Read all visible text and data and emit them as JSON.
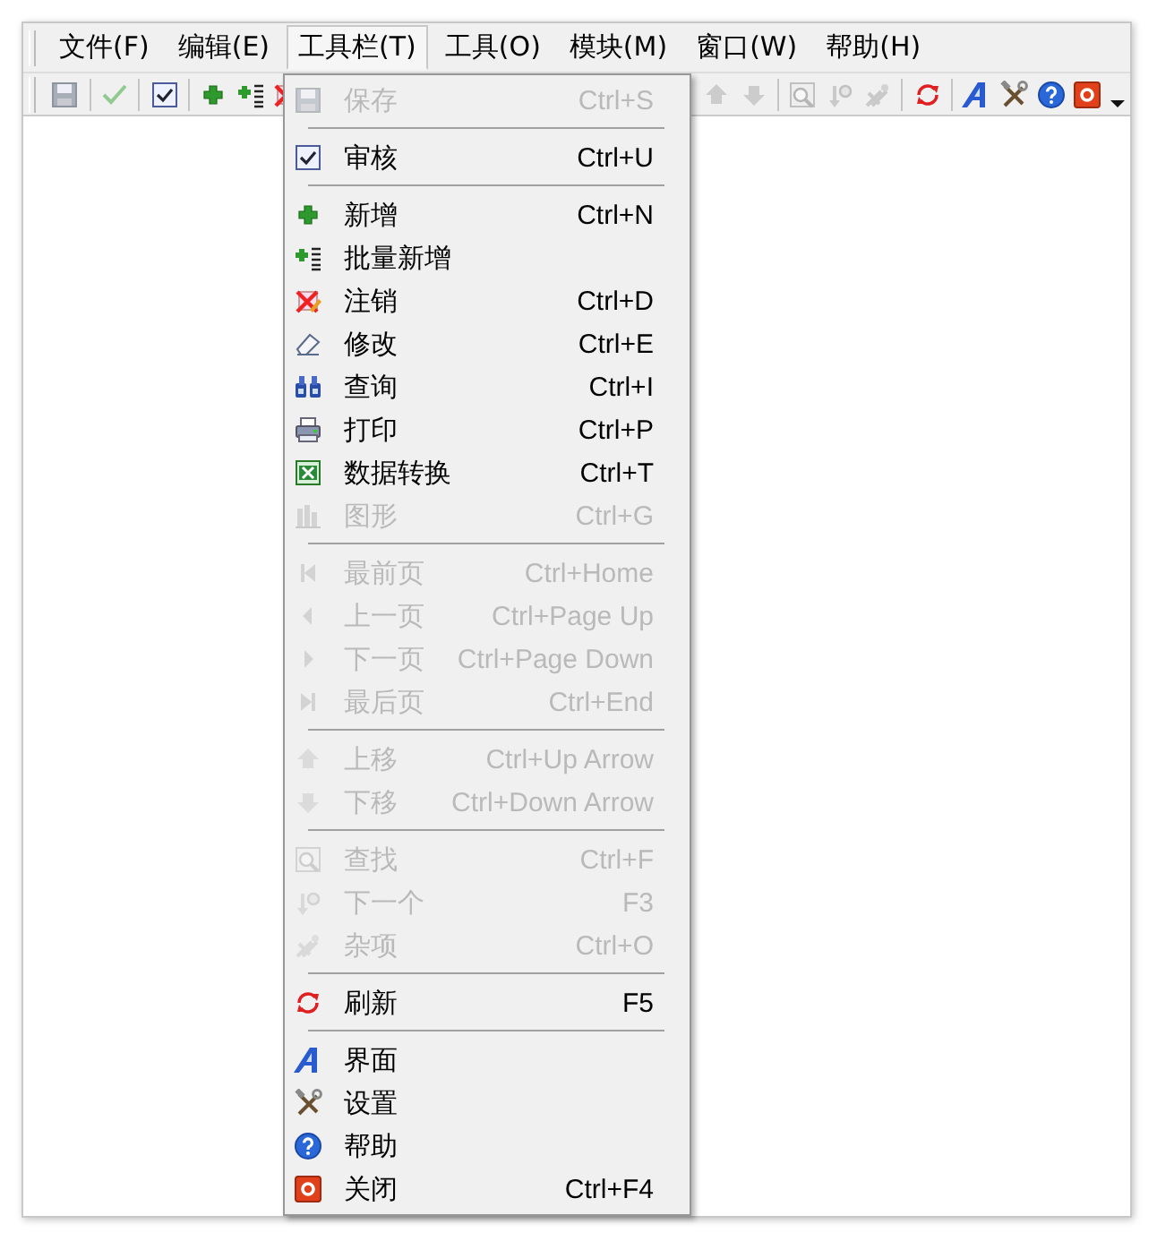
{
  "menubar": [
    {
      "label": "文件(F)",
      "selected": false
    },
    {
      "label": "编辑(E)",
      "selected": false
    },
    {
      "label": "工具栏(T)",
      "selected": true
    },
    {
      "label": "工具(O)",
      "selected": false
    },
    {
      "label": "模块(M)",
      "selected": false
    },
    {
      "label": "窗口(W)",
      "selected": false
    },
    {
      "label": "帮助(H)",
      "selected": false
    }
  ],
  "toolbar_left": [
    {
      "kind": "save",
      "disabled": true
    },
    {
      "kind": "sep"
    },
    {
      "kind": "check",
      "disabled": true
    },
    {
      "kind": "sep"
    },
    {
      "kind": "checkbox",
      "disabled": false
    },
    {
      "kind": "sep"
    },
    {
      "kind": "add",
      "disabled": false
    },
    {
      "kind": "batch",
      "disabled": false
    },
    {
      "kind": "delete",
      "disabled": false
    }
  ],
  "toolbar_right": [
    {
      "kind": "up",
      "disabled": true
    },
    {
      "kind": "down",
      "disabled": true
    },
    {
      "kind": "sep"
    },
    {
      "kind": "search",
      "disabled": true
    },
    {
      "kind": "findnext",
      "disabled": true
    },
    {
      "kind": "misc",
      "disabled": true
    },
    {
      "kind": "sep"
    },
    {
      "kind": "refresh",
      "disabled": false
    },
    {
      "kind": "sep"
    },
    {
      "kind": "ui",
      "disabled": false
    },
    {
      "kind": "settings",
      "disabled": false
    },
    {
      "kind": "help",
      "disabled": false
    },
    {
      "kind": "close",
      "disabled": false
    },
    {
      "kind": "more",
      "disabled": false
    }
  ],
  "menu": [
    [
      {
        "kind": "save",
        "label": "保存",
        "shortcut": "Ctrl+S",
        "disabled": true
      }
    ],
    [
      {
        "kind": "checkbox",
        "label": "审核",
        "shortcut": "Ctrl+U",
        "disabled": false
      }
    ],
    [
      {
        "kind": "add",
        "label": "新增",
        "shortcut": "Ctrl+N",
        "disabled": false
      },
      {
        "kind": "batch",
        "label": "批量新增",
        "disabled": false
      },
      {
        "kind": "delete",
        "label": "注销",
        "shortcut": "Ctrl+D",
        "disabled": false
      },
      {
        "kind": "edit",
        "label": "修改",
        "shortcut": "Ctrl+E",
        "disabled": false
      },
      {
        "kind": "find",
        "label": "查询",
        "shortcut": "Ctrl+I",
        "disabled": false
      },
      {
        "kind": "print",
        "label": "打印",
        "shortcut": "Ctrl+P",
        "disabled": false
      },
      {
        "kind": "excel",
        "label": "数据转换",
        "shortcut": "Ctrl+T",
        "disabled": false
      },
      {
        "kind": "chart",
        "label": "图形",
        "shortcut": "Ctrl+G",
        "disabled": true
      }
    ],
    [
      {
        "kind": "first",
        "label": "最前页",
        "shortcut": "Ctrl+Home",
        "disabled": true
      },
      {
        "kind": "prev",
        "label": "上一页",
        "shortcut": "Ctrl+Page Up",
        "disabled": true
      },
      {
        "kind": "next",
        "label": "下一页",
        "shortcut": "Ctrl+Page Down",
        "disabled": true
      },
      {
        "kind": "last",
        "label": "最后页",
        "shortcut": "Ctrl+End",
        "disabled": true
      }
    ],
    [
      {
        "kind": "up",
        "label": "上移",
        "shortcut": "Ctrl+Up Arrow",
        "disabled": true
      },
      {
        "kind": "down",
        "label": "下移",
        "shortcut": "Ctrl+Down Arrow",
        "disabled": true
      }
    ],
    [
      {
        "kind": "search",
        "label": "查找",
        "shortcut": "Ctrl+F",
        "disabled": true
      },
      {
        "kind": "findnext",
        "label": "下一个",
        "shortcut": "F3",
        "disabled": true
      },
      {
        "kind": "misc",
        "label": "杂项",
        "shortcut": "Ctrl+O",
        "disabled": true
      }
    ],
    [
      {
        "kind": "refresh",
        "label": "刷新",
        "shortcut": "F5",
        "disabled": false
      }
    ],
    [
      {
        "kind": "ui",
        "label": "界面",
        "disabled": false
      },
      {
        "kind": "settings",
        "label": "设置",
        "disabled": false
      },
      {
        "kind": "help",
        "label": "帮助",
        "disabled": false
      },
      {
        "kind": "close",
        "label": "关闭",
        "shortcut": "Ctrl+F4",
        "disabled": false
      }
    ]
  ]
}
